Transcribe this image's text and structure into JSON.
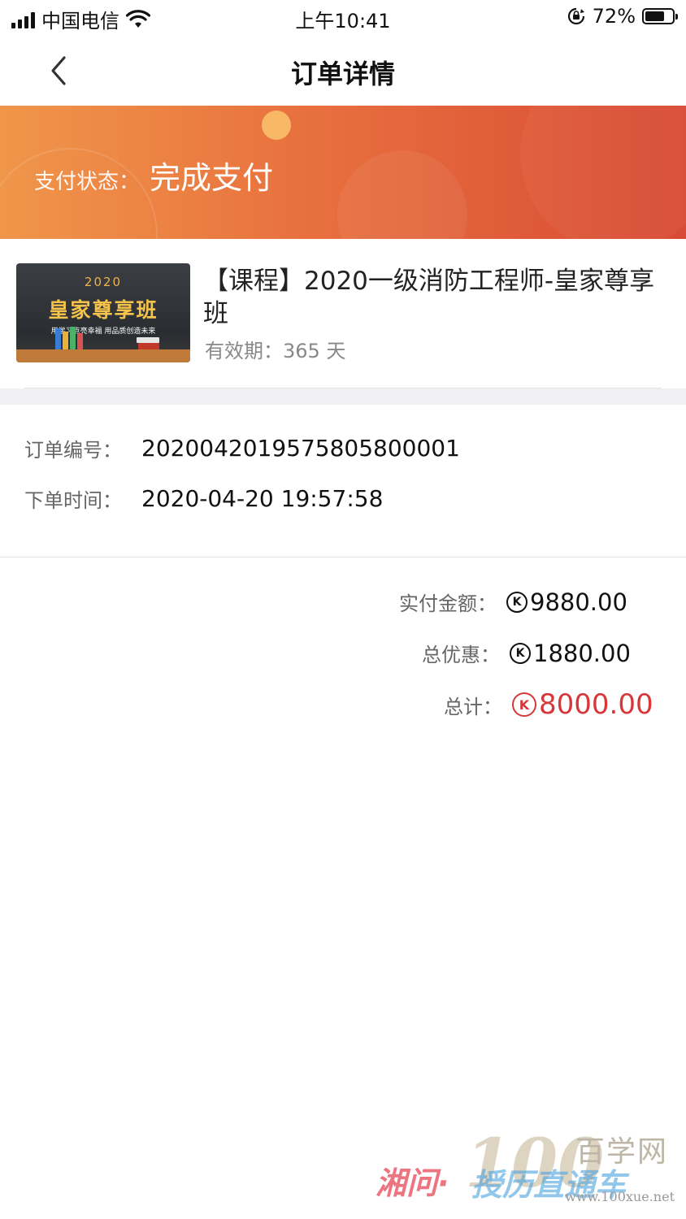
{
  "status_bar": {
    "carrier": "中国电信",
    "time": "上午10:41",
    "battery_percent": "72%",
    "battery_level": 0.72,
    "icons": [
      "signal-icon",
      "wifi-icon",
      "rotation-lock-icon",
      "battery-icon"
    ]
  },
  "nav": {
    "title": "订单详情",
    "back_icon": "chevron-left-icon"
  },
  "banner": {
    "label": "支付状态：",
    "value": "完成支付",
    "colors": {
      "start": "#f0964a",
      "end": "#d84a35"
    }
  },
  "product": {
    "thumbnail": {
      "year": "2020",
      "title": "皇家尊享班",
      "subtitle": "用学习点亮幸福  用品质创造未来"
    },
    "title": "【课程】2020一级消防工程师-皇家尊享班",
    "validity": "有效期：365 天"
  },
  "order_info": {
    "order_no_label": "订单编号：",
    "order_no": "2020042019575805800001",
    "time_label": "下单时间：",
    "time": "2020-04-20 19:57:58"
  },
  "totals": {
    "paid_label": "实付金额：",
    "paid": "9880.00",
    "discount_label": "总优惠：",
    "discount": "1880.00",
    "total_label": "总计：",
    "total": "8000.00",
    "currency_icon": "k-coin-icon",
    "currency_glyph": "K",
    "accent": "#d6383a"
  },
  "watermark": {
    "number": "100",
    "cn": "百学网",
    "red_text": "湘问·",
    "blue_text": "授历直通车",
    "url": "www.100xue.net"
  }
}
